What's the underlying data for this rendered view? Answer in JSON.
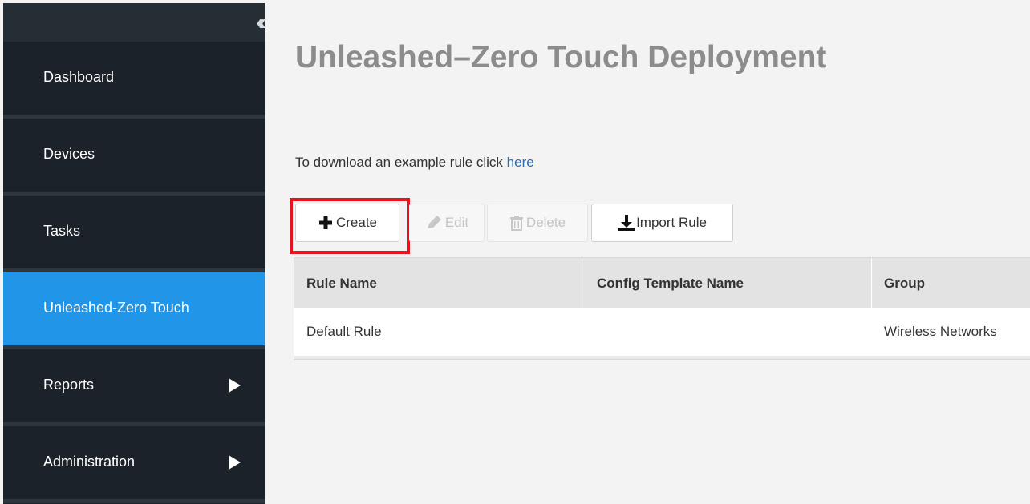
{
  "sidebar": {
    "items": [
      {
        "label": "Dashboard"
      },
      {
        "label": "Devices"
      },
      {
        "label": "Tasks"
      },
      {
        "label": "Unleashed-Zero Touch",
        "active": true
      },
      {
        "label": "Reports",
        "has_submenu": true
      },
      {
        "label": "Administration",
        "has_submenu": true
      }
    ]
  },
  "page": {
    "title": "Unleashed–Zero Touch Deployment",
    "intro_text": "To download an example rule click ",
    "intro_link": "here"
  },
  "toolbar": {
    "create_label": "Create",
    "edit_label": "Edit",
    "delete_label": "Delete",
    "import_label": "Import Rule"
  },
  "table": {
    "columns": [
      "Rule Name",
      "Config Template Name",
      "Group"
    ],
    "rows": [
      {
        "rule_name": "Default Rule",
        "config_template_name": "",
        "group": "Wireless Networks"
      }
    ]
  },
  "colors": {
    "sidebar_bg": "#1b2229",
    "active_item": "#2196e8",
    "highlight_border": "#e8131e",
    "link": "#2a6db6"
  }
}
